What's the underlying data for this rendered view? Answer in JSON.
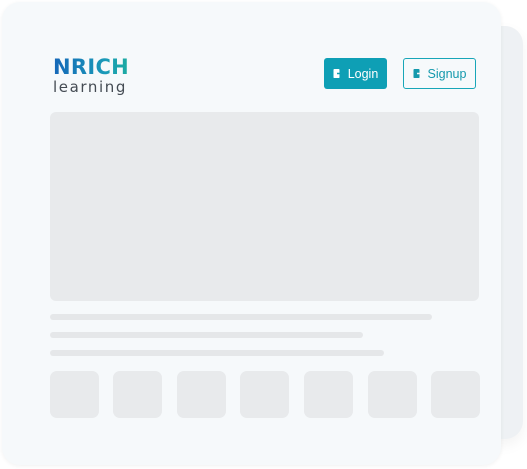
{
  "brand": {
    "name": "NRICH",
    "tagline": "learning"
  },
  "header": {
    "login_label": "Login",
    "signup_label": "Signup"
  },
  "colors": {
    "accent": "#0e9fb5",
    "brand_blue": "#1567b8",
    "brand_green": "#1fb98f",
    "placeholder": "#e8eaec",
    "card": "#f6f9fb"
  },
  "icons": {
    "login": "login-icon",
    "signup": "signup-icon"
  }
}
